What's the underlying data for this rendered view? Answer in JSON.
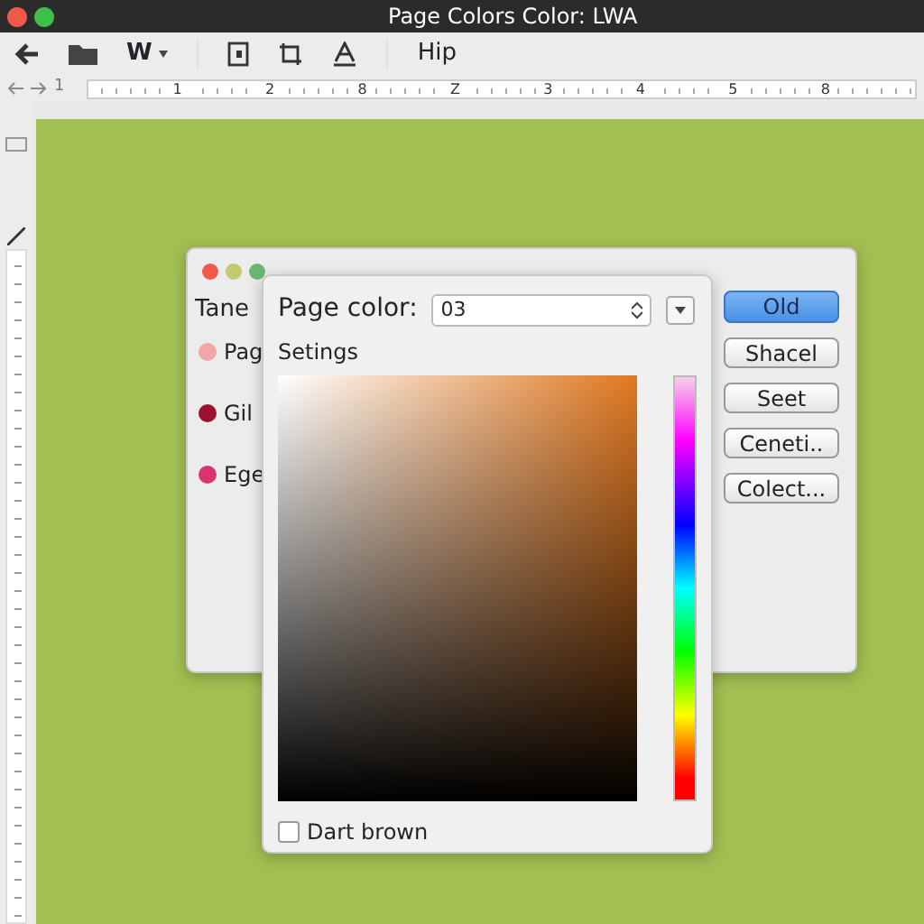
{
  "window": {
    "title": "Page Colors Color: LWA"
  },
  "toolbar": {
    "font_menu": "W",
    "label": "Hip"
  },
  "ruler": {
    "indent_label": "1",
    "numbers": [
      "1",
      "2",
      "8",
      "Z",
      "3",
      "4",
      "5",
      "8"
    ]
  },
  "back_dialog": {
    "list_title": "Tane",
    "items": [
      {
        "label": "Pag",
        "color": "#f2a6a6"
      },
      {
        "label": "Gil",
        "color": "#9c1030"
      },
      {
        "label": "Ege",
        "color": "#d83470"
      }
    ],
    "buttons": [
      {
        "label": "Old",
        "default": true
      },
      {
        "label": "Shacel",
        "default": false
      },
      {
        "label": "Seet",
        "default": false
      },
      {
        "label": "Ceneti..",
        "default": false
      },
      {
        "label": "Colect...",
        "default": false
      }
    ]
  },
  "color_dialog": {
    "label": "Page color:",
    "value": "03",
    "section": "Setings",
    "checkbox": {
      "label": "Dart brown",
      "checked": false
    }
  }
}
